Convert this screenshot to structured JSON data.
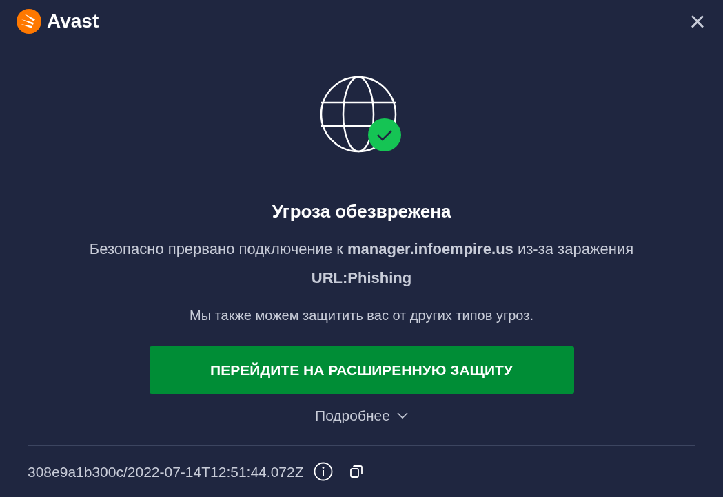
{
  "brand": {
    "name": "Avast"
  },
  "close": {
    "label": "×"
  },
  "status": {
    "title": "Угроза обезврежена",
    "description": "Безопасно прервано подключение к **manager.infoempire.us** из-за заражения **URL:Phishing**",
    "note": "Мы также можем защитить вас от других типов угроз."
  },
  "action_button": {
    "label": "ПЕРЕЙДИТЕ НА РАСШИРЕННУЮ ЗАЩИТУ"
  },
  "details": {
    "label": "Подробнее",
    "expanded": false
  },
  "footer": {
    "id": "308e9a1b300c/2022-07-14T12:51:44.072Z"
  }
}
